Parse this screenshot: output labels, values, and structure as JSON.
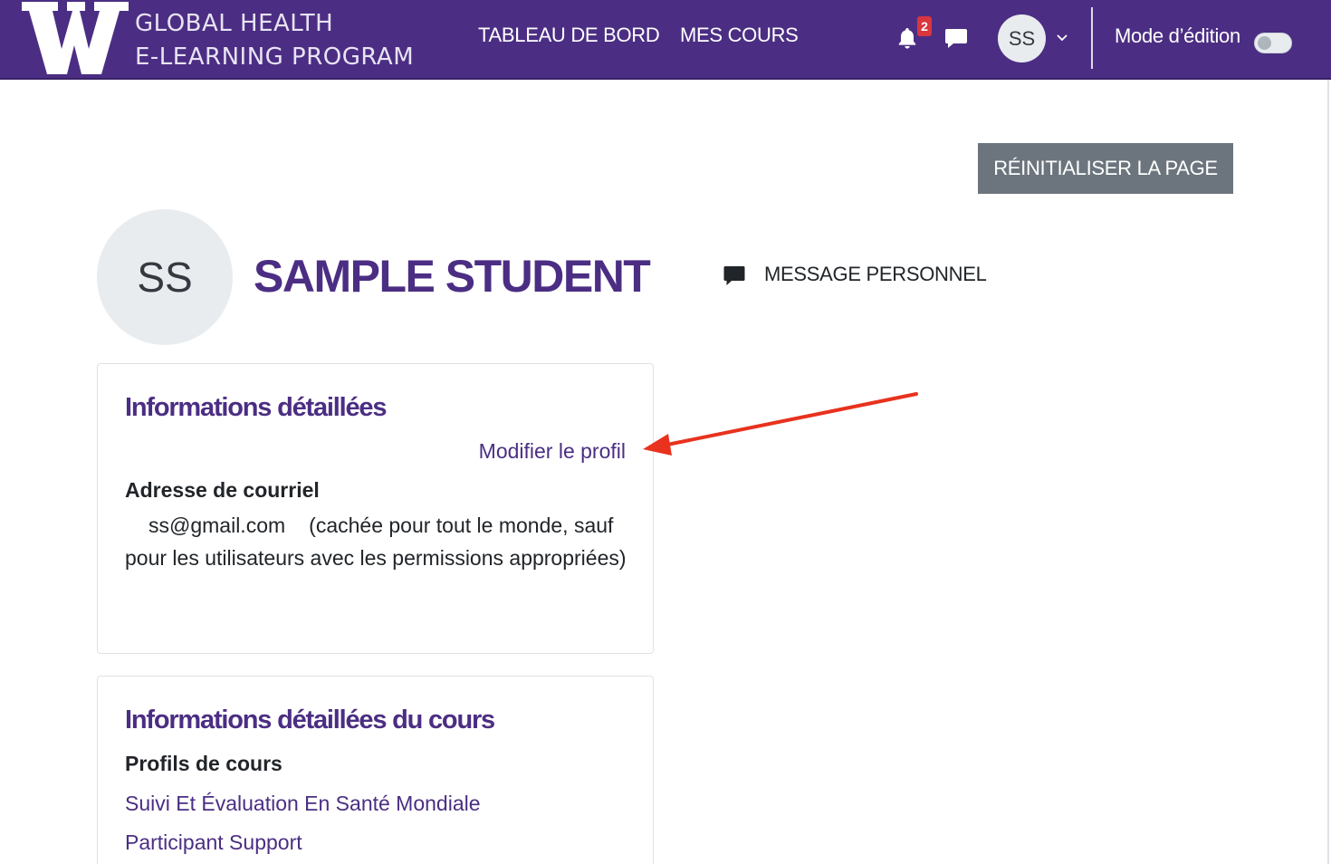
{
  "header": {
    "logo_letter": "W",
    "brand_line1": "GLOBAL HEALTH",
    "brand_line2": "E-LEARNING PROGRAM",
    "nav": [
      {
        "label": "TABLEAU DE BORD"
      },
      {
        "label": "MES COURS"
      }
    ],
    "notification_count": "2",
    "user_initials": "SS",
    "edit_mode_label": "Mode d’édition",
    "edit_mode_on": false
  },
  "page": {
    "reset_button": "RÉINITIALISER LA PAGE"
  },
  "profile": {
    "initials": "SS",
    "name": "SAMPLE STUDENT",
    "message_label": "MESSAGE PERSONNEL"
  },
  "details_card": {
    "title": "Informations détaillées",
    "edit_link": "Modifier le profil",
    "email_label": "Adresse de courriel",
    "email_value": "ss@gmail.com",
    "email_note": "(cachée pour tout le monde, sauf pour les utilisateurs avec les permissions appropriées)"
  },
  "course_card": {
    "title": "Informations détaillées du cours",
    "profiles_label": "Profils de cours",
    "courses": [
      {
        "label": "Suivi Et Évaluation En Santé Mondiale"
      },
      {
        "label": "Participant Support"
      }
    ]
  },
  "colors": {
    "brand_purple": "#4b2e83",
    "badge_red": "#d9363e",
    "button_gray": "#6c757d",
    "annotation_red": "#e8321e"
  },
  "icons": {
    "notification": "bell-icon",
    "messages": "chat-icon",
    "user_menu": "chevron-down-icon",
    "personal_message": "message-icon"
  }
}
